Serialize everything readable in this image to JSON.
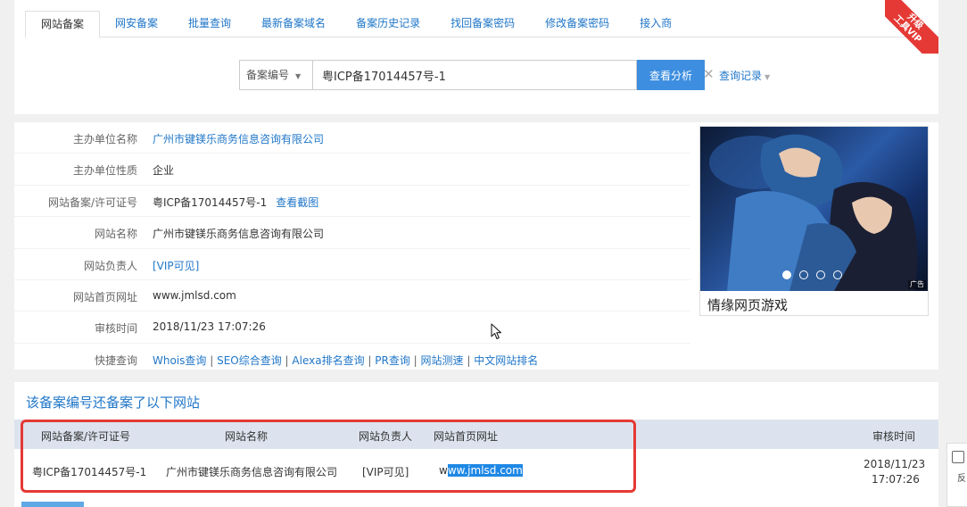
{
  "tabs": [
    {
      "label": "网站备案",
      "active": true
    },
    {
      "label": "网安备案"
    },
    {
      "label": "批量查询"
    },
    {
      "label": "最新备案域名"
    },
    {
      "label": "备案历史记录"
    },
    {
      "label": "找回备案密码"
    },
    {
      "label": "修改备案密码"
    },
    {
      "label": "接入商"
    }
  ],
  "vip": {
    "line1": "升级",
    "line2": "工具VIP"
  },
  "search": {
    "select_value": "备案编号",
    "input_value": "粤ICP备17014457号-1",
    "submit_label": "查看分析",
    "history_label": "查询记录"
  },
  "info": {
    "rows": [
      {
        "label": "主办单位名称",
        "value": "广州市键镁乐商务信息咨询有限公司"
      },
      {
        "label": "主办单位性质",
        "value": "企业"
      },
      {
        "label": "网站备案/许可证号",
        "value": "粤ICP备17014457号-1",
        "link": "查看截图"
      },
      {
        "label": "网站名称",
        "value": "广州市键镁乐商务信息咨询有限公司"
      },
      {
        "label": "网站负责人",
        "value": "[VIP可见]"
      },
      {
        "label": "网站首页网址",
        "value": "www.jmlsd.com"
      },
      {
        "label": "审核时间",
        "value": "2018/11/23 17:07:26"
      },
      {
        "label": "快捷查询",
        "links": [
          "Whois查询",
          "SEO综合查询",
          "Alexa排名查询",
          "PR查询",
          "网站测速",
          "中文网站排名"
        ]
      }
    ]
  },
  "ad": {
    "caption": "情缘网页游戏",
    "tag": "广告",
    "slides": 4,
    "active_slide": 0
  },
  "section": {
    "title": "该备案编号还备案了以下网站",
    "columns": [
      "网站备案/许可证号",
      "网站名称",
      "网站负责人",
      "网站首页网址",
      "审核时间"
    ],
    "rows": [
      {
        "license": "粤ICP备17014457号-1",
        "name": "广州市键镁乐商务信息咨询有限公司",
        "owner": "[VIP可见]",
        "url_prefix": "w",
        "url_selected": "ww.jmlsd.com",
        "date": "2018/11/23",
        "time": "17:07:26"
      }
    ]
  },
  "side": {
    "label": "反"
  }
}
